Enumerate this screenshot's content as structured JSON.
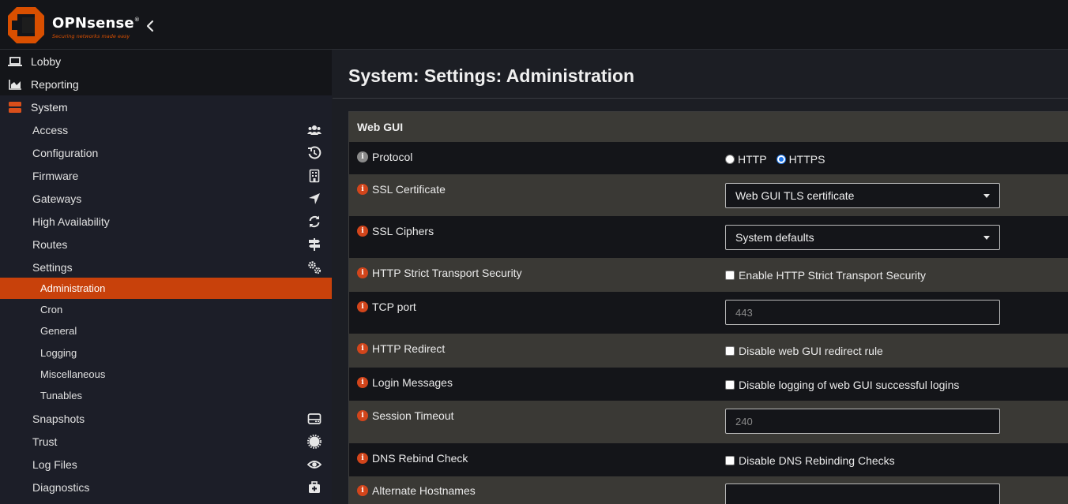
{
  "header": {
    "brand": "OPNsense",
    "brand_mark": "®",
    "tagline": "Securing networks made easy"
  },
  "sidebar": {
    "top_items": [
      {
        "label": "Lobby",
        "icon": "laptop-icon"
      },
      {
        "label": "Reporting",
        "icon": "area-chart-icon"
      },
      {
        "label": "System",
        "icon": "server-icon"
      }
    ],
    "system_items": [
      {
        "label": "Access",
        "icon": "users-icon"
      },
      {
        "label": "Configuration",
        "icon": "history-icon"
      },
      {
        "label": "Firmware",
        "icon": "building-icon"
      },
      {
        "label": "Gateways",
        "icon": "location-arrow-icon"
      },
      {
        "label": "High Availability",
        "icon": "refresh-icon"
      },
      {
        "label": "Routes",
        "icon": "signpost-icon"
      },
      {
        "label": "Settings",
        "icon": "cogs-icon"
      }
    ],
    "settings_items": [
      {
        "label": "Administration",
        "active": true
      },
      {
        "label": "Cron"
      },
      {
        "label": "General"
      },
      {
        "label": "Logging"
      },
      {
        "label": "Miscellaneous"
      },
      {
        "label": "Tunables"
      }
    ],
    "more_items": [
      {
        "label": "Snapshots",
        "icon": "hdd-icon"
      },
      {
        "label": "Trust",
        "icon": "certificate-icon"
      },
      {
        "label": "Log Files",
        "icon": "eye-icon"
      },
      {
        "label": "Diagnostics",
        "icon": "medkit-icon"
      }
    ]
  },
  "main": {
    "title": "System: Settings: Administration",
    "panel_title": "Web GUI",
    "protocol": {
      "label": "Protocol",
      "options": [
        "HTTP",
        "HTTPS"
      ],
      "selected": "HTTPS"
    },
    "ssl_certificate": {
      "label": "SSL Certificate",
      "value": "Web GUI TLS certificate"
    },
    "ssl_ciphers": {
      "label": "SSL Ciphers",
      "value": "System defaults"
    },
    "hsts": {
      "label": "HTTP Strict Transport Security",
      "checkbox": "Enable HTTP Strict Transport Security",
      "checked": false
    },
    "tcp_port": {
      "label": "TCP port",
      "placeholder": "443"
    },
    "http_redirect": {
      "label": "HTTP Redirect",
      "checkbox": "Disable web GUI redirect rule",
      "checked": false
    },
    "login_messages": {
      "label": "Login Messages",
      "checkbox": "Disable logging of web GUI successful logins",
      "checked": false
    },
    "session_timeout": {
      "label": "Session Timeout",
      "placeholder": "240"
    },
    "dns_rebind": {
      "label": "DNS Rebind Check",
      "checkbox": "Disable DNS Rebinding Checks",
      "checked": false
    },
    "alternate_hostnames": {
      "label": "Alternate Hostnames",
      "value": ""
    }
  },
  "colors": {
    "accent": "#c8410b",
    "header_bg": "#141519",
    "panel_head": "#3b3a36",
    "info_orange": "#d2451b"
  }
}
